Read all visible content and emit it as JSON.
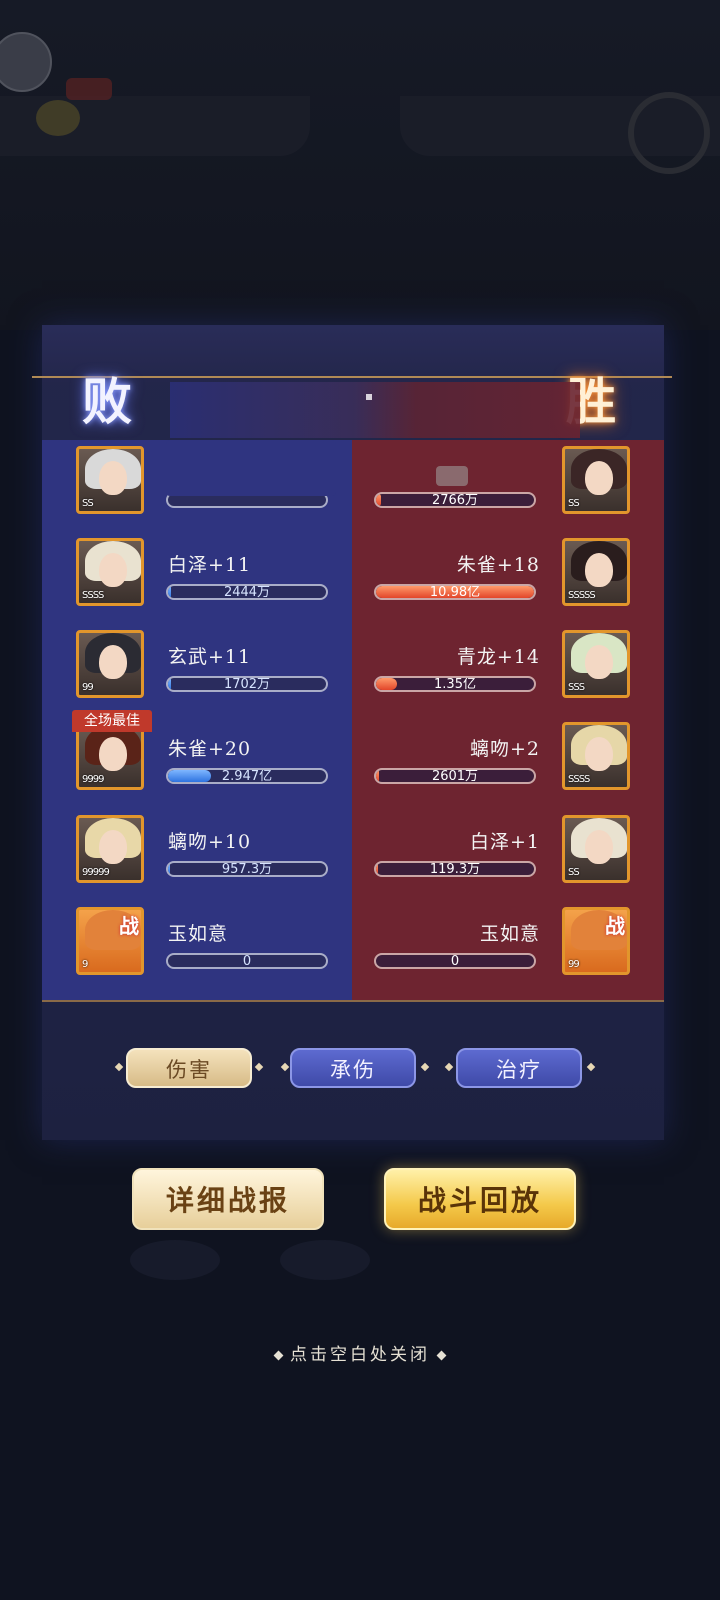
{
  "result": {
    "left": "败",
    "right": "胜"
  },
  "left_team": [
    {
      "name": "",
      "value": "",
      "fill": 0.0,
      "stars": "SS"
    },
    {
      "name": "白泽+11",
      "value": "2444万",
      "fill": 0.02,
      "stars": "SSSS"
    },
    {
      "name": "玄武+11",
      "value": "1702万",
      "fill": 0.02,
      "stars": "99"
    },
    {
      "name": "朱雀+20",
      "value": "2.947亿",
      "fill": 0.27,
      "stars": "9999"
    },
    {
      "name": "螭吻+10",
      "value": "957.3万",
      "fill": 0.01,
      "stars": "99999"
    },
    {
      "name": "玉如意",
      "value": "0",
      "fill": 0.0,
      "stars": "9"
    }
  ],
  "right_team": [
    {
      "name": "",
      "value": "2766万",
      "fill": 0.03,
      "stars": "SS"
    },
    {
      "name": "朱雀+18",
      "value": "10.98亿",
      "fill": 1.0,
      "stars": "SSSSS"
    },
    {
      "name": "青龙+14",
      "value": "1.35亿",
      "fill": 0.13,
      "stars": "SSS"
    },
    {
      "name": "螭吻+2",
      "value": "2601万",
      "fill": 0.02,
      "stars": "SSSS"
    },
    {
      "name": "白泽+1",
      "value": "119.3万",
      "fill": 0.01,
      "stars": "SS"
    },
    {
      "name": "玉如意",
      "value": "0",
      "fill": 0.0,
      "stars": "99"
    }
  ],
  "mvp_label": "全场最佳",
  "battle_badge": "战",
  "tabs": {
    "damage": "伤害",
    "taken": "承伤",
    "heal": "治疗"
  },
  "buttons": {
    "detail": "详细战报",
    "replay": "战斗回放"
  },
  "close_hint": "点击空白处关闭",
  "colors": {
    "left_panel": "#2f3480",
    "right_panel": "#6e2430",
    "accent_gold": "#e2962c"
  }
}
